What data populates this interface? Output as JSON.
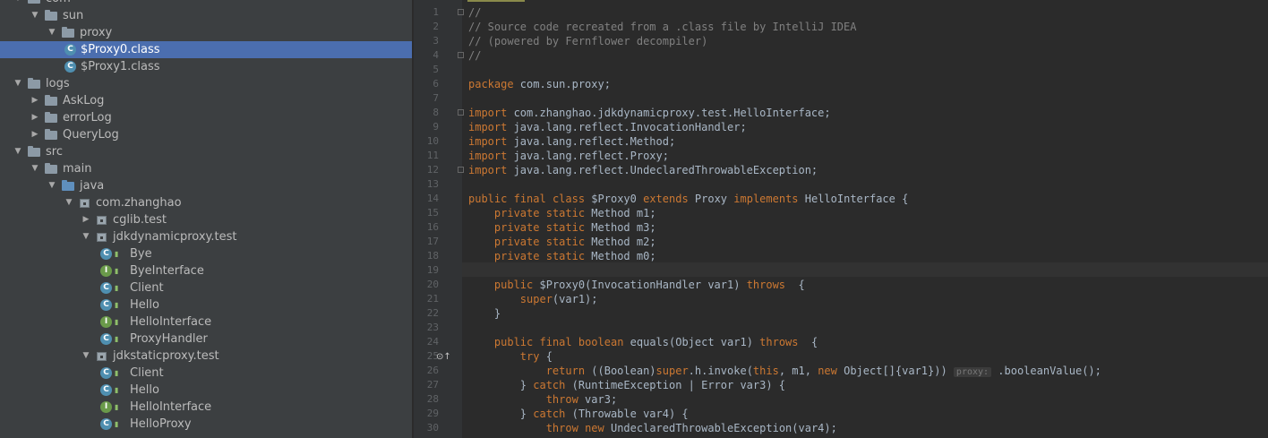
{
  "tree": {
    "rows": [
      {
        "label": "com",
        "type": "folder",
        "expanded": true
      },
      {
        "label": "sun",
        "type": "folder",
        "expanded": true
      },
      {
        "label": "proxy",
        "type": "folder",
        "expanded": true
      },
      {
        "label": "$Proxy0.class",
        "type": "class-file",
        "selected": true
      },
      {
        "label": "$Proxy1.class",
        "type": "class-file"
      },
      {
        "label": "logs",
        "type": "folder",
        "expanded": true
      },
      {
        "label": "AskLog",
        "type": "folder",
        "expanded": false
      },
      {
        "label": "errorLog",
        "type": "folder",
        "expanded": false
      },
      {
        "label": "QueryLog",
        "type": "folder",
        "expanded": false
      },
      {
        "label": "src",
        "type": "folder",
        "expanded": true
      },
      {
        "label": "main",
        "type": "folder",
        "expanded": true
      },
      {
        "label": "java",
        "type": "source-folder",
        "expanded": true
      },
      {
        "label": "com.zhanghao",
        "type": "package",
        "expanded": true
      },
      {
        "label": "cglib.test",
        "type": "package",
        "expanded": false
      },
      {
        "label": "jdkdynamicproxy.test",
        "type": "package",
        "expanded": true
      },
      {
        "label": "Bye",
        "type": "class"
      },
      {
        "label": "ByeInterface",
        "type": "interface"
      },
      {
        "label": "Client",
        "type": "class"
      },
      {
        "label": "Hello",
        "type": "class"
      },
      {
        "label": "HelloInterface",
        "type": "interface"
      },
      {
        "label": "ProxyHandler",
        "type": "class"
      },
      {
        "label": "jdkstaticproxy.test",
        "type": "package",
        "expanded": true
      },
      {
        "label": "Client",
        "type": "class"
      },
      {
        "label": "Hello",
        "type": "class"
      },
      {
        "label": "HelloInterface",
        "type": "interface"
      },
      {
        "label": "HelloProxy",
        "type": "class"
      }
    ]
  },
  "editor": {
    "lines": [
      {
        "n": "1",
        "t": "//"
      },
      {
        "n": "2",
        "t": "// Source code recreated from a .class file by IntelliJ IDEA"
      },
      {
        "n": "3",
        "t": "// (powered by Fernflower decompiler)"
      },
      {
        "n": "4",
        "t": "//"
      },
      {
        "n": "5",
        "t": ""
      },
      {
        "n": "6",
        "t": "package com.sun.proxy;"
      },
      {
        "n": "7",
        "t": ""
      },
      {
        "n": "8",
        "t": "import com.zhanghao.jdkdynamicproxy.test.HelloInterface;"
      },
      {
        "n": "9",
        "t": "import java.lang.reflect.InvocationHandler;"
      },
      {
        "n": "10",
        "t": "import java.lang.reflect.Method;"
      },
      {
        "n": "11",
        "t": "import java.lang.reflect.Proxy;"
      },
      {
        "n": "12",
        "t": "import java.lang.reflect.UndeclaredThrowableException;"
      },
      {
        "n": "13",
        "t": ""
      },
      {
        "n": "14",
        "t": "public final class $Proxy0 extends Proxy implements HelloInterface {"
      },
      {
        "n": "15",
        "t": "    private static Method m1;"
      },
      {
        "n": "16",
        "t": "    private static Method m3;"
      },
      {
        "n": "17",
        "t": "    private static Method m2;"
      },
      {
        "n": "18",
        "t": "    private static Method m0;"
      },
      {
        "n": "19",
        "t": ""
      },
      {
        "n": "20",
        "t": "    public $Proxy0(InvocationHandler var1) throws  {"
      },
      {
        "n": "21",
        "t": "        super(var1);"
      },
      {
        "n": "22",
        "t": "    }"
      },
      {
        "n": "23",
        "t": ""
      },
      {
        "n": "24",
        "t": "    public final boolean equals(Object var1) throws  {"
      },
      {
        "n": "25",
        "t": "        try {"
      },
      {
        "n": "26",
        "t": "            return ((Boolean)super.h.invoke(this, m1, new Object[]{var1})) proxy: .booleanValue();"
      },
      {
        "n": "27",
        "t": "        } catch (RuntimeException | Error var3) {"
      },
      {
        "n": "28",
        "t": "            throw var3;"
      },
      {
        "n": "29",
        "t": "        } catch (Throwable var4) {"
      },
      {
        "n": "30",
        "t": "            throw new UndeclaredThrowableException(var4);"
      }
    ]
  },
  "colors": {
    "tree_bg": "#3c3f41",
    "selection": "#4b6eaf",
    "editor_bg": "#2b2b2b",
    "keyword": "#cc7832",
    "comment": "#808080",
    "text": "#a9b7c6"
  }
}
